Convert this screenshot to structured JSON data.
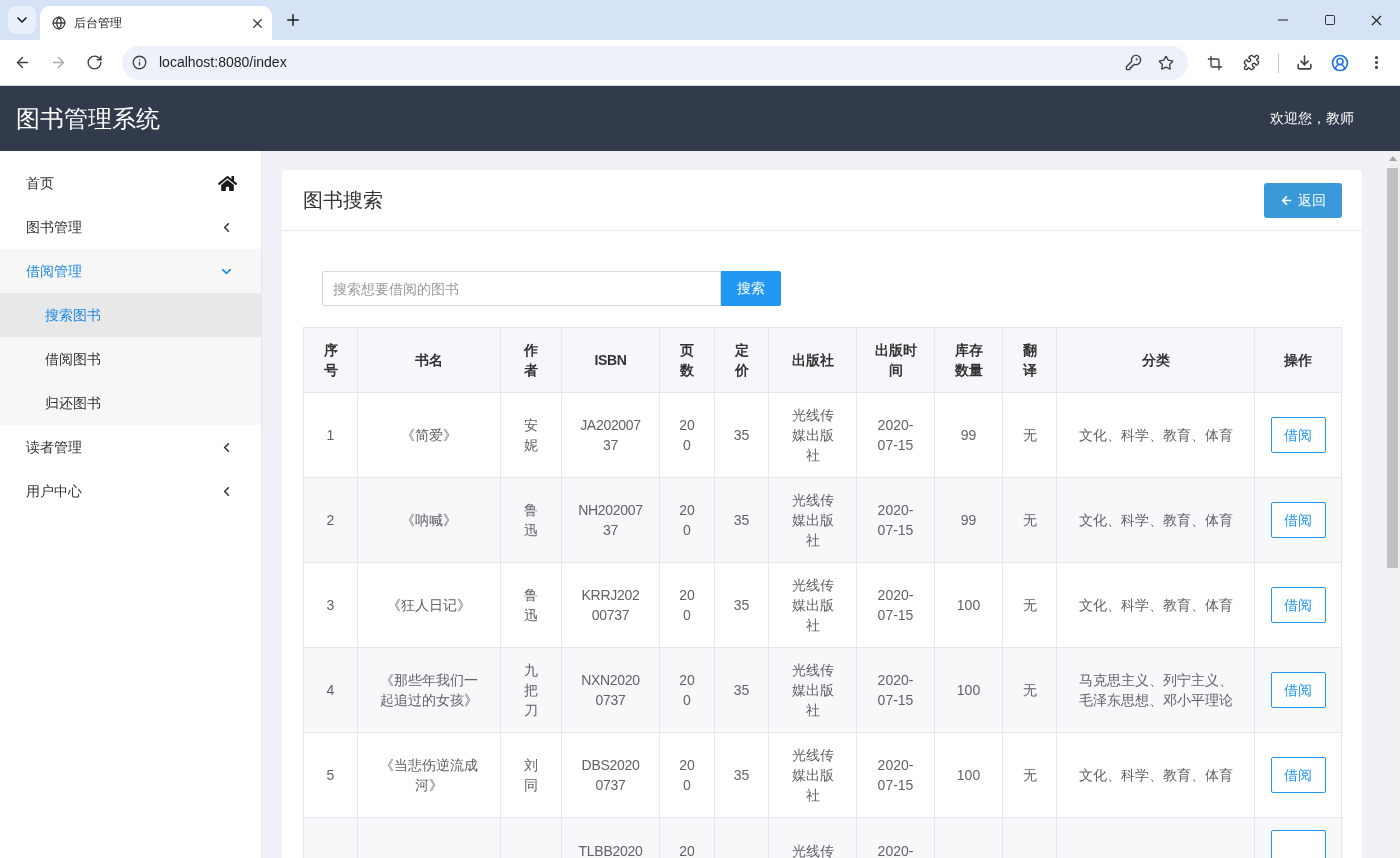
{
  "browser": {
    "tabs": [
      {
        "title": "后台管理",
        "selected": true
      }
    ],
    "nav": [
      {
        "kind": "back",
        "disabled": false
      },
      {
        "kind": "forward",
        "disabled": true
      },
      {
        "kind": "reload",
        "disabled": false
      }
    ],
    "address": "localhost:8080/index"
  },
  "header": {
    "title": "图书管理系统",
    "greeting": "欢迎您，教师"
  },
  "sidebar": {
    "items": [
      {
        "label": "首页",
        "kind": "home",
        "selected": false
      },
      {
        "label": "图书管理",
        "kind": "group",
        "selected": false,
        "expanded": false
      },
      {
        "label": "借阅管理",
        "kind": "group",
        "selected": false,
        "expanded": true,
        "children": [
          {
            "label": "搜索图书",
            "selected": true
          },
          {
            "label": "借阅图书",
            "selected": false
          },
          {
            "label": "归还图书",
            "selected": false
          }
        ]
      },
      {
        "label": "读者管理",
        "kind": "group",
        "selected": false,
        "expanded": false
      },
      {
        "label": "用户中心",
        "kind": "group",
        "selected": false,
        "expanded": false
      }
    ]
  },
  "card": {
    "title": "图书搜索",
    "back_button": "返回",
    "search": {
      "placeholder": "搜索想要借阅的图书",
      "button": "搜索"
    }
  },
  "table": {
    "columns": [
      "序号",
      "书名",
      "作者",
      "ISBN",
      "页数",
      "定价",
      "出版社",
      "出版时间",
      "库存数量",
      "翻译",
      "分类",
      "操作"
    ],
    "rows": [
      {
        "index": "1",
        "title": "《简爱》",
        "author": "安妮",
        "isbn": "JA20200737",
        "pages": "200",
        "price": "35",
        "publisher": "光线传媒出版社",
        "published": "2020-07-15",
        "stock": "99",
        "translated": "无",
        "category": "文化、科学、教育、体育",
        "action": "借阅"
      },
      {
        "index": "2",
        "title": "《呐喊》",
        "author": "鲁迅",
        "isbn": "NH20200737",
        "pages": "200",
        "price": "35",
        "publisher": "光线传媒出版社",
        "published": "2020-07-15",
        "stock": "99",
        "translated": "无",
        "category": "文化、科学、教育、体育",
        "action": "借阅"
      },
      {
        "index": "3",
        "title": "《狂人日记》",
        "author": "鲁迅",
        "isbn": "KRRJ20200737",
        "pages": "200",
        "price": "35",
        "publisher": "光线传媒出版社",
        "published": "2020-07-15",
        "stock": "100",
        "translated": "无",
        "category": "文化、科学、教育、体育",
        "action": "借阅"
      },
      {
        "index": "4",
        "title": "《那些年我们一起追过的女孩》",
        "author": "九把刀",
        "isbn": "NXN20200737",
        "pages": "200",
        "price": "35",
        "publisher": "光线传媒出版社",
        "published": "2020-07-15",
        "stock": "100",
        "translated": "无",
        "category": "马克思主义、列宁主义、毛泽东思想、邓小平理论",
        "action": "借阅"
      },
      {
        "index": "5",
        "title": "《当悲伤逆流成河》",
        "author": "刘同",
        "isbn": "DBS20200737",
        "pages": "200",
        "price": "35",
        "publisher": "光线传媒出版社",
        "published": "2020-07-15",
        "stock": "100",
        "translated": "无",
        "category": "文化、科学、教育、体育",
        "action": "借阅"
      },
      {
        "isbn": "TLBB2020",
        "pages": "20",
        "publisher": "光线传",
        "published": "2020-"
      }
    ]
  }
}
